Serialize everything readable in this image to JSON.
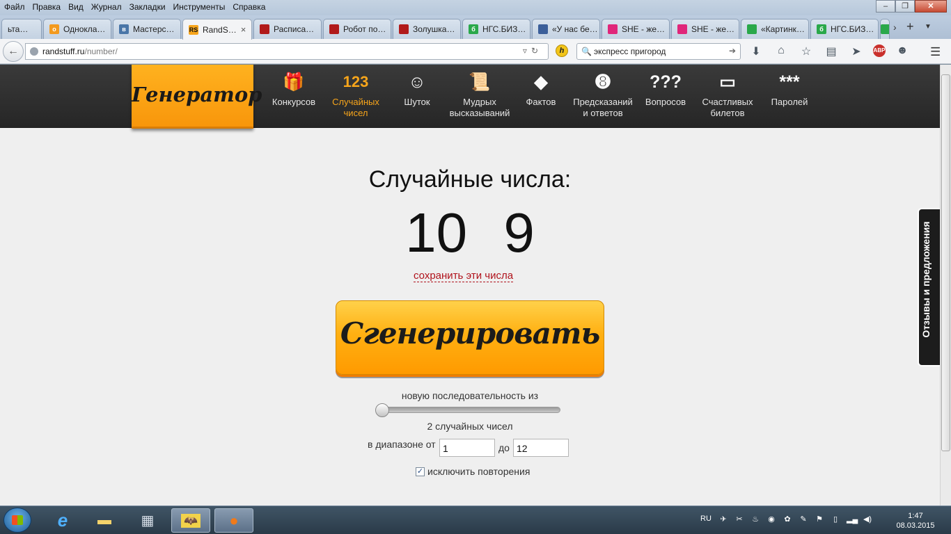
{
  "menubar": {
    "items": [
      "Файл",
      "Правка",
      "Вид",
      "Журнал",
      "Закладки",
      "Инструменты",
      "Справка"
    ]
  },
  "tabs": [
    {
      "label": "ьта…",
      "color": "#8a8a8a"
    },
    {
      "label": "Однокла…",
      "color": "#f39a1e"
    },
    {
      "label": "Мастерс…",
      "color": "#4a76a8"
    },
    {
      "label": "RandS…",
      "color": "#f7a51b"
    },
    {
      "label": "Расписа…",
      "color": "#b11a1a"
    },
    {
      "label": "Робот по…",
      "color": "#b11a1a"
    },
    {
      "label": "Золушка…",
      "color": "#b11a1a"
    },
    {
      "label": "НГС.БИЗ…",
      "color": "#2aa84a"
    },
    {
      "label": "«У нас бе…",
      "color": "#3b5f9a"
    },
    {
      "label": "SHE - же…",
      "color": "#e0267a"
    },
    {
      "label": "SHE - же…",
      "color": "#e0267a"
    },
    {
      "label": "«Картинк…",
      "color": "#2aa84a"
    },
    {
      "label": "НГС.БИЗ…",
      "color": "#2aa84a"
    }
  ],
  "tab_favicon_rs": "RS",
  "tab_close": "×",
  "url": {
    "host": "randstuff.ru",
    "path": "/number/"
  },
  "search": {
    "value": "экспресс пригород"
  },
  "site": {
    "logo": "Генератор",
    "nav": [
      {
        "icon": "gift-icon",
        "glyph": "🎁",
        "label": "Конкурсов"
      },
      {
        "icon": "numbers-icon",
        "glyph": "123",
        "label": "Случайных чисел"
      },
      {
        "icon": "smiley-icon",
        "glyph": "☺",
        "label": "Шуток"
      },
      {
        "icon": "scroll-icon",
        "glyph": "📜",
        "label": "Мудрых высказываний"
      },
      {
        "icon": "warning-icon",
        "glyph": "◆",
        "label": "Фактов"
      },
      {
        "icon": "eight-ball-icon",
        "glyph": "➑",
        "label": "Предсказаний и ответов"
      },
      {
        "icon": "question-icon",
        "glyph": "???",
        "label": "Вопросов"
      },
      {
        "icon": "ticket-icon",
        "glyph": "▭",
        "label": "Счастливых билетов"
      },
      {
        "icon": "password-icon",
        "glyph": "***",
        "label": "Паролей"
      }
    ],
    "feedback": "Отзывы и предложения"
  },
  "generator": {
    "title": "Случайные числа:",
    "numbers": [
      "10",
      "9"
    ],
    "save_link": "сохранить эти числа",
    "button": "Сгенерировать",
    "sequence_label": "новую последовательность из",
    "slider_value": 2,
    "count_label": "2 случайных чисел",
    "range_label": "в диапазоне от",
    "from_value": "1",
    "to_label": "до",
    "to_value": "12",
    "exclude_label": "исключить повторения",
    "exclude_checked": true
  },
  "taskbar": {
    "lang": "RU",
    "time": "1:47",
    "date": "08.03.2015"
  }
}
